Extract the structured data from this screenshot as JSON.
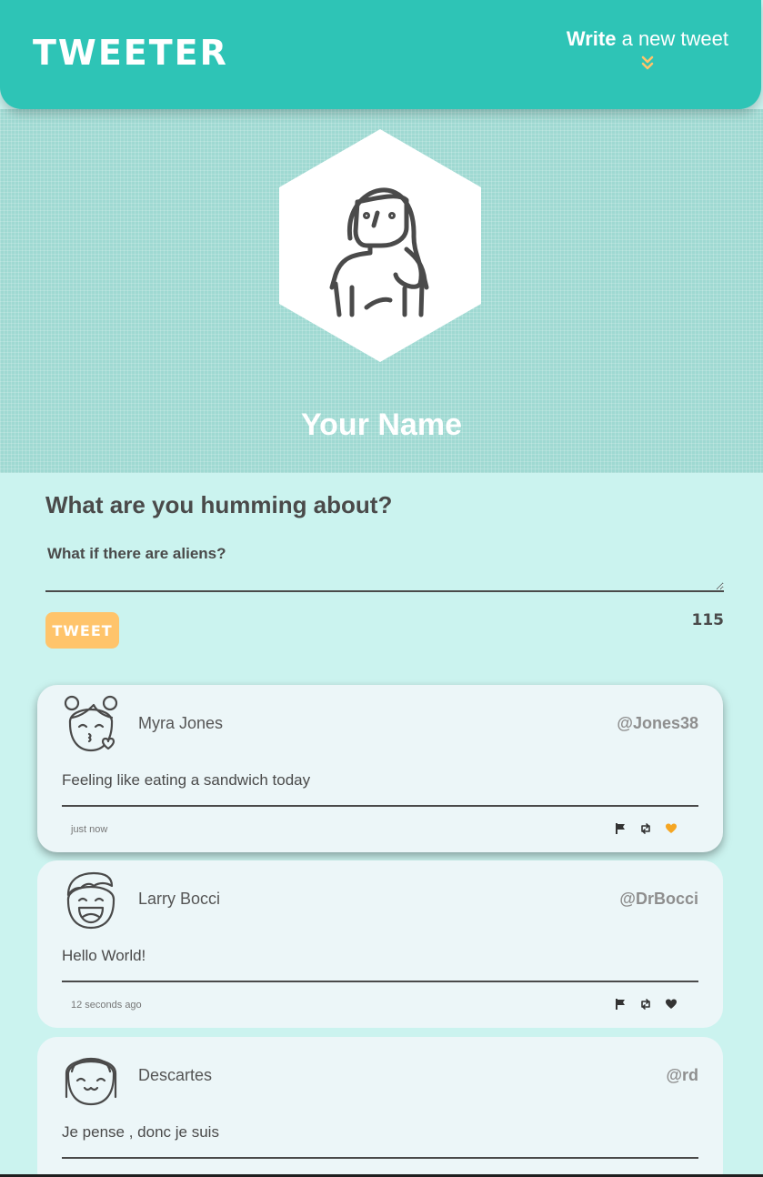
{
  "nav": {
    "brand": "TWEETER",
    "compose_bold": "Write",
    "compose_light": " a new tweet",
    "chevron_icon": "double-chevron-down-icon",
    "colors": {
      "bar": "#2ec4b6",
      "chevron": "#ffc46b"
    }
  },
  "profile": {
    "avatar_icon": "woman-avatar-icon",
    "name": "Your Name"
  },
  "composer": {
    "heading": "What are you humming about?",
    "placeholder": "What if there are aliens?",
    "button_label": "TWEET",
    "counter": "115",
    "button_color": "#ffc46b"
  },
  "tweets": [
    {
      "avatar_icon": "girl-kiss-avatar-icon",
      "name": "Myra Jones",
      "handle": "@Jones38",
      "content": "Feeling like eating a sandwich today",
      "time": "just now",
      "liked": true
    },
    {
      "avatar_icon": "boy-laughing-avatar-icon",
      "name": "Larry Bocci",
      "handle": "@DrBocci",
      "content": "Hello World!",
      "time": "12 seconds ago",
      "liked": false
    },
    {
      "avatar_icon": "girl-bangs-avatar-icon",
      "name": "Descartes",
      "handle": "@rd",
      "content": "Je pense , donc je suis",
      "time": "",
      "liked": false
    }
  ],
  "action_icons": [
    "flag-icon",
    "retweet-icon",
    "heart-icon"
  ],
  "like_color": "#f5a623"
}
